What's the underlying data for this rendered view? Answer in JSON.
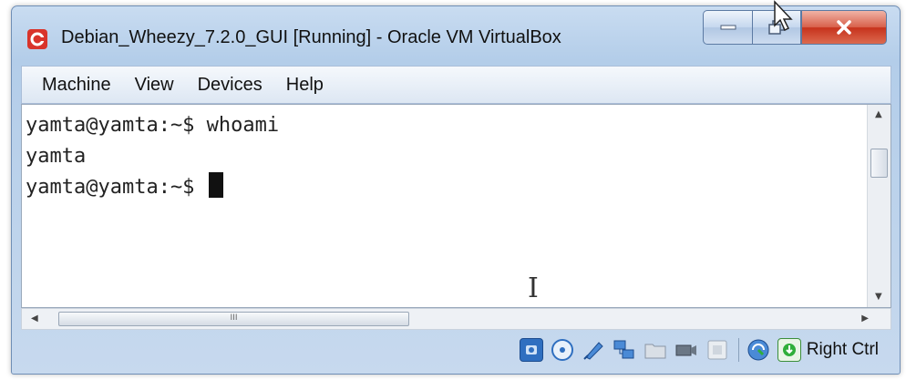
{
  "window": {
    "title": "Debian_Wheezy_7.2.0_GUI [Running] - Oracle VM VirtualBox",
    "caption_buttons": [
      "minimize",
      "maximize",
      "close"
    ]
  },
  "menu": {
    "items": [
      {
        "label": "Machine"
      },
      {
        "label": "View"
      },
      {
        "label": "Devices"
      },
      {
        "label": "Help"
      }
    ]
  },
  "terminal": {
    "lines": [
      "yamta@yamta:~$ whoami",
      "yamta",
      "yamta@yamta:~$ "
    ]
  },
  "scrollbar": {
    "grip": "III"
  },
  "statusbar": {
    "icons": [
      "hard-disk-icon",
      "optical-drive-icon",
      "usb-icon",
      "network-icon",
      "shared-folders-icon",
      "video-capture-icon",
      "display-icon",
      "mouse-integration-icon",
      "keyboard-capture-icon"
    ],
    "host_key_label": "Right Ctrl"
  },
  "colors": {
    "title_bg": "#b3cde9",
    "close_button": "#c6321c",
    "terminal_bg": "#ffffff",
    "terminal_text": "#222222"
  }
}
